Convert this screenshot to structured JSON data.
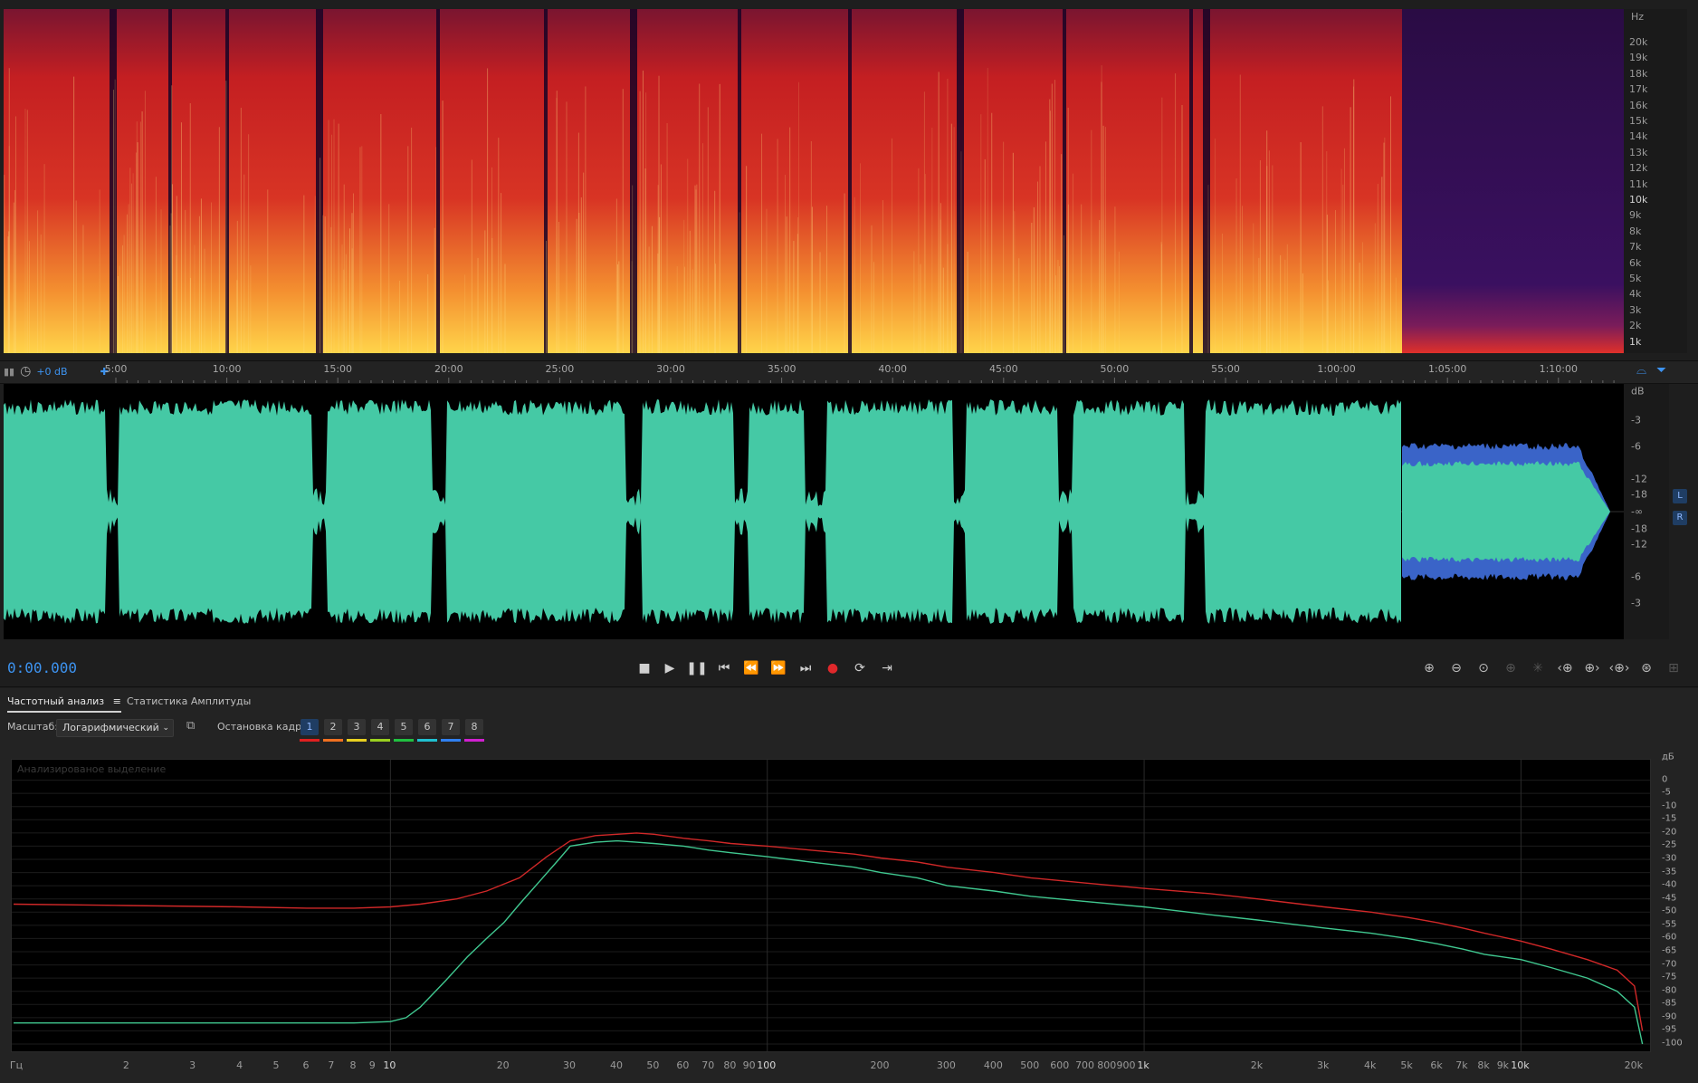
{
  "spectrogram": {
    "unit": "Hz",
    "scale_labels": [
      "20k",
      "19k",
      "18k",
      "17k",
      "16k",
      "15k",
      "14k",
      "13k",
      "12k",
      "11k",
      "10k",
      "9k",
      "8k",
      "7k",
      "6k",
      "5k",
      "4k",
      "3k",
      "2k",
      "1k"
    ],
    "colors": {
      "low": "#12041c",
      "mid": "#c41f22",
      "high": "#ffd44a"
    }
  },
  "ruler": {
    "gain_label": "+0 dB",
    "time_labels": [
      "5:00",
      "10:00",
      "15:00",
      "20:00",
      "25:00",
      "30:00",
      "35:00",
      "40:00",
      "45:00",
      "50:00",
      "55:00",
      "1:00:00",
      "1:05:00",
      "1:10:00"
    ]
  },
  "waveform": {
    "unit": "dB",
    "scale_labels": [
      "-3",
      "-6",
      "-12",
      "-18",
      "-∞",
      "-18",
      "-12",
      "-6",
      "-3"
    ],
    "channels": [
      "L",
      "R"
    ],
    "colors": {
      "wave": "#45c9a5",
      "quiet": "#3a64c8",
      "bg": "#000000"
    }
  },
  "transport": {
    "timecode": "0:00.000",
    "buttons": [
      "stop-icon",
      "play-icon",
      "pause-icon",
      "go-to-start-icon",
      "rewind-icon",
      "fast-forward-icon",
      "go-to-end-icon",
      "record-icon",
      "loop-icon",
      "skip-selection-icon"
    ],
    "zoom_buttons": [
      "zoom-in-amplitude-icon",
      "zoom-out-amplitude-icon",
      "zoom-reset-icon",
      "zoom-in-disabled-icon",
      "zoom-out-disabled-icon",
      "zoom-in-left-icon",
      "zoom-in-right-icon",
      "zoom-selection-icon",
      "zoom-full-icon",
      "zoom-extra-icon"
    ]
  },
  "panel": {
    "tabs": [
      {
        "label": "Частотный анализ",
        "active": true
      },
      {
        "label": "Статистика Амплитуды",
        "active": false
      }
    ],
    "scale_label": "Масштаб:",
    "scale_value": "Логарифмический",
    "freeze_label": "Остановка кадра:",
    "frames": [
      {
        "label": "1",
        "color": "#e02020"
      },
      {
        "label": "2",
        "color": "#f07020"
      },
      {
        "label": "3",
        "color": "#e8d020"
      },
      {
        "label": "4",
        "color": "#9ad020"
      },
      {
        "label": "5",
        "color": "#20c040"
      },
      {
        "label": "6",
        "color": "#20c0d0"
      },
      {
        "label": "7",
        "color": "#3080f0"
      },
      {
        "label": "8",
        "color": "#d020d0"
      }
    ],
    "plot_caption": "Анализированое выделение"
  },
  "chart_data": {
    "type": "line",
    "xscale": "log",
    "xlabel": "Гц",
    "ylabel": "дБ",
    "xlim": [
      1,
      22000
    ],
    "ylim": [
      -100,
      5
    ],
    "x_tick_labels": [
      "2",
      "3",
      "4",
      "5",
      "6",
      "7",
      "8",
      "9",
      "10",
      "20",
      "30",
      "40",
      "50",
      "60",
      "70",
      "80",
      "90",
      "100",
      "200",
      "300",
      "400",
      "500",
      "600",
      "700",
      "800",
      "900",
      "1k",
      "2k",
      "3k",
      "4k",
      "5k",
      "6k",
      "7k",
      "8k",
      "9k",
      "10k",
      "20k"
    ],
    "y_tick_labels": [
      "0",
      "-5",
      "-10",
      "-15",
      "-20",
      "-25",
      "-30",
      "-35",
      "-40",
      "-45",
      "-50",
      "-55",
      "-60",
      "-65",
      "-70",
      "-75",
      "-80",
      "-85",
      "-90",
      "-95",
      "-100"
    ],
    "series": [
      {
        "color": "#d02828",
        "x": [
          1,
          2,
          4,
          6,
          8,
          10,
          12,
          15,
          18,
          22,
          26,
          30,
          35,
          40,
          45,
          50,
          60,
          70,
          80,
          100,
          130,
          170,
          200,
          250,
          300,
          400,
          500,
          700,
          1000,
          1500,
          2000,
          3000,
          4000,
          5000,
          6000,
          7000,
          8000,
          10000,
          12000,
          15000,
          18000,
          20000,
          21000
        ],
        "y": [
          -47,
          -47.5,
          -48,
          -48.5,
          -48.5,
          -48,
          -47,
          -45,
          -42,
          -37,
          -29,
          -23,
          -21,
          -20.5,
          -20,
          -20.5,
          -22,
          -23,
          -24,
          -25,
          -26.5,
          -28,
          -29.5,
          -31,
          -33,
          -35,
          -37,
          -39,
          -41,
          -43,
          -45,
          -48,
          -50,
          -52,
          -54,
          -56,
          -58,
          -61,
          -64,
          -68,
          -72,
          -78,
          -95
        ]
      },
      {
        "color": "#40c890",
        "x": [
          1,
          2,
          4,
          6,
          8,
          10,
          11,
          12,
          14,
          16,
          18,
          20,
          22,
          25,
          28,
          30,
          35,
          40,
          45,
          50,
          60,
          70,
          80,
          100,
          130,
          170,
          200,
          250,
          300,
          400,
          500,
          700,
          1000,
          1500,
          2000,
          3000,
          4000,
          5000,
          6000,
          7000,
          8000,
          10000,
          12000,
          15000,
          18000,
          20000,
          21000
        ],
        "y": [
          -92,
          -92,
          -92,
          -92,
          -92,
          -91.5,
          -90,
          -86,
          -76,
          -67,
          -60,
          -54,
          -47,
          -38,
          -30,
          -25,
          -23.5,
          -23,
          -23.5,
          -24,
          -25,
          -26.5,
          -27.5,
          -29,
          -31,
          -33,
          -35,
          -37,
          -40,
          -42,
          -44,
          -46,
          -48,
          -51,
          -53,
          -56,
          -58,
          -60,
          -62,
          -64,
          -66,
          -68,
          -71,
          -75,
          -80,
          -86,
          -100
        ]
      }
    ]
  }
}
